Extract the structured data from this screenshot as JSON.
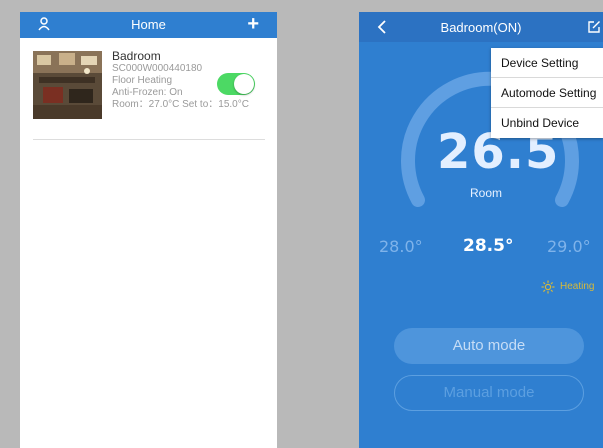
{
  "left_screen": {
    "header": {
      "title": "Home"
    },
    "device": {
      "name": "Badroom",
      "serial": "SC000W000440180",
      "type": "Floor Heating",
      "anti_frozen": "Anti-Frozen: On",
      "room_line": "Room：27.0°C Set to：15.0°C",
      "switch_on": true
    }
  },
  "right_screen": {
    "header": {
      "title": "Badroom(ON)"
    },
    "menu": {
      "items": [
        "Device Setting",
        "Automode Setting",
        "Unbind Device"
      ]
    },
    "current_temp": "26.5",
    "room_label": "Room",
    "temps": {
      "lower": "28.0°",
      "setpoint": "28.5°",
      "higher": "29.0°"
    },
    "status": "Heating",
    "buttons": {
      "auto": "Auto mode",
      "manual": "Manual mode"
    }
  },
  "colors": {
    "primary_blue": "#2f7fd0",
    "header_blue_dark": "#2c72c2",
    "switch_green": "#4cd964",
    "heating_yellow": "#d6b93a"
  },
  "icons": [
    "user-icon",
    "plus-icon",
    "back-icon",
    "edit-icon",
    "sun-icon"
  ]
}
